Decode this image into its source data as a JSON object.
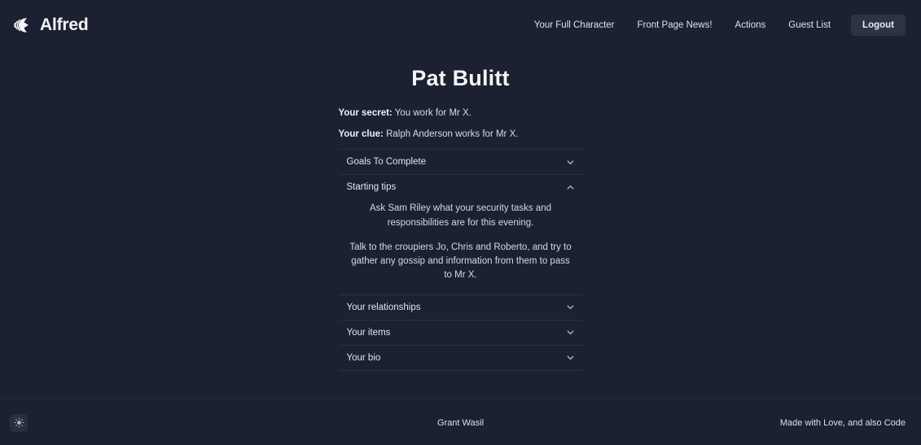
{
  "header": {
    "brand": {
      "name": "Alfred",
      "icon": "alfred-logo-icon"
    },
    "nav": [
      {
        "label": "Your Full Character",
        "name": "nav-your-full-character"
      },
      {
        "label": "Front Page News!",
        "name": "nav-front-page-news"
      },
      {
        "label": "Actions",
        "name": "nav-actions"
      },
      {
        "label": "Guest List",
        "name": "nav-guest-list"
      }
    ],
    "logout_label": "Logout"
  },
  "main": {
    "character_name": "Pat Bulitt",
    "secret_label": "Your secret:",
    "secret_text": "You work for Mr X.",
    "clue_label": "Your clue:",
    "clue_text": "Ralph Anderson works for Mr X.",
    "accordion": [
      {
        "title": "Goals To Complete",
        "state": "collapsed",
        "icon": "chevron-down-icon"
      },
      {
        "title": "Starting tips",
        "state": "expanded",
        "icon": "chevron-up-icon"
      },
      {
        "title": "Your relationships",
        "state": "collapsed",
        "icon": "chevron-down-icon"
      },
      {
        "title": "Your items",
        "state": "collapsed",
        "icon": "chevron-down-icon"
      },
      {
        "title": "Your bio",
        "state": "collapsed",
        "icon": "chevron-down-icon"
      }
    ],
    "starting_tips": [
      "Ask Sam Riley what your security tasks and responsibilities are for this evening.",
      "Talk to the croupiers Jo, Chris and Roberto, and try to gather any gossip and information from them to pass to Mr X."
    ]
  },
  "footer": {
    "theme_toggle_icon": "sun-icon",
    "credit": "Grant Wasil",
    "made_with": "Made with Love, and also Code"
  },
  "colors": {
    "background": "#1b2130",
    "text": "#e8eaf2",
    "border": "#2a3142",
    "button": "#2c3344"
  }
}
